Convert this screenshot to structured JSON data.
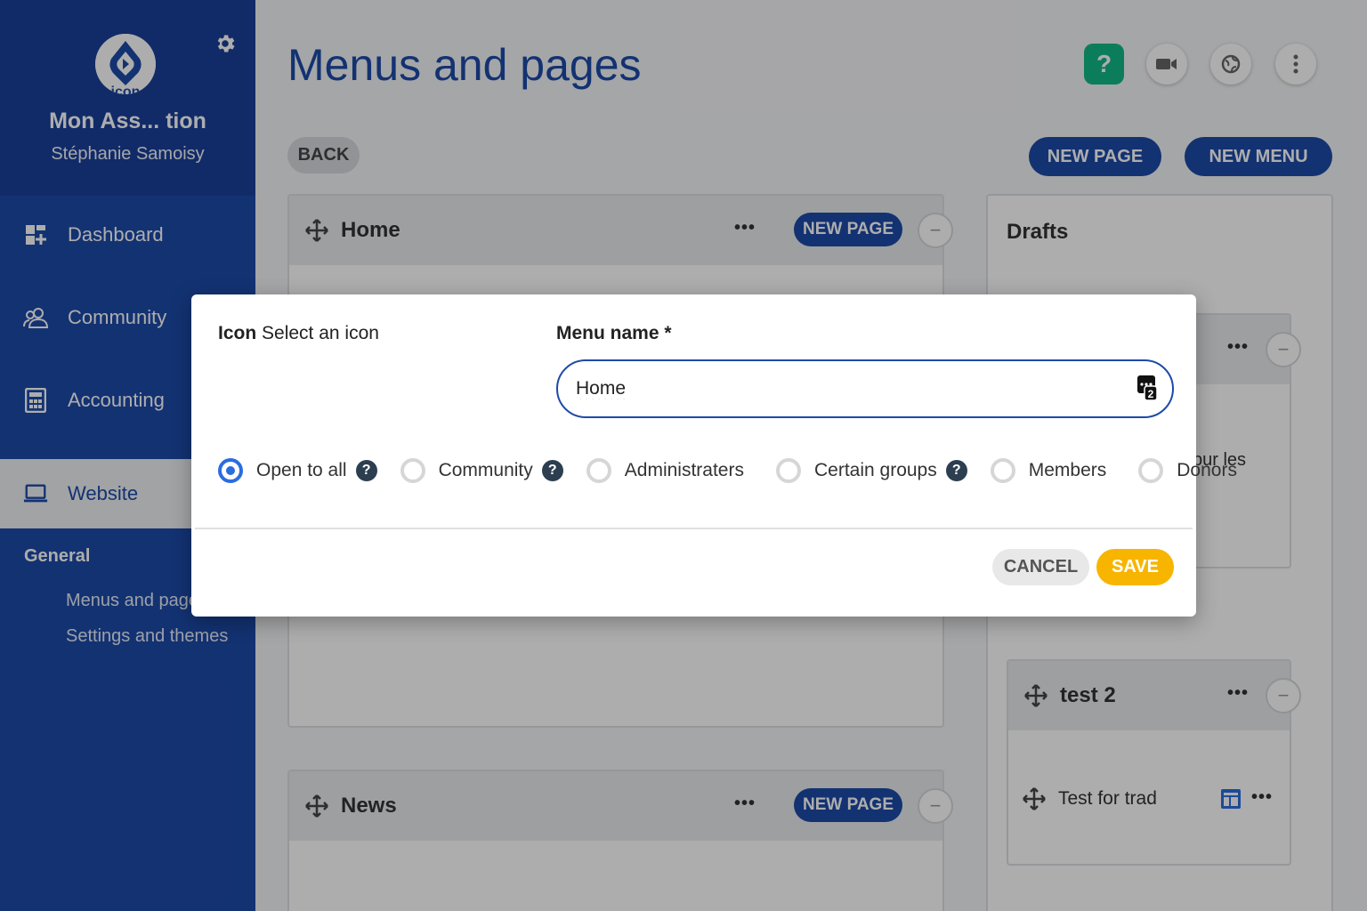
{
  "sidebar": {
    "org_name": "Mon Ass... tion",
    "user_name": "Stéphanie Samoisy",
    "logo_text": "icon",
    "nav": [
      {
        "label": "Dashboard",
        "icon": "dashboard-icon"
      },
      {
        "label": "Community",
        "icon": "community-icon"
      },
      {
        "label": "Accounting",
        "icon": "calculator-icon"
      },
      {
        "label": "Website",
        "icon": "laptop-icon"
      }
    ],
    "section_title": "General",
    "sub_items": [
      "Menus and pages",
      "Settings and themes"
    ]
  },
  "header": {
    "title": "Menus and pages",
    "help_label": "?"
  },
  "toolbar": {
    "back_label": "BACK",
    "new_page_label": "NEW PAGE",
    "new_menu_label": "NEW MENU"
  },
  "menus": [
    {
      "title": "Home",
      "new_page_label": "NEW PAGE",
      "more_label": "•••",
      "collapse_label": "−"
    },
    {
      "title": "News",
      "new_page_label": "NEW PAGE",
      "more_label": "•••",
      "collapse_label": "−"
    }
  ],
  "drafts": {
    "title": "Drafts",
    "partial_text": "pur les",
    "card_more_label": "•••",
    "collapse_label": "−",
    "test_menu": {
      "title": "test 2",
      "page_label": "Test for trad",
      "more_label": "•••"
    }
  },
  "dialog": {
    "icon_label": "Icon",
    "icon_hint": "Select an icon",
    "menu_name_label": "Menu name *",
    "menu_name_value": "Home",
    "badge_text": "2",
    "visibility_options": [
      {
        "label": "Open to all",
        "checked": true,
        "help": true
      },
      {
        "label": "Community",
        "checked": false,
        "help": true
      },
      {
        "label": "Administraters",
        "checked": false,
        "help": false
      },
      {
        "label": "Certain groups",
        "checked": false,
        "help": true
      },
      {
        "label": "Members",
        "checked": false,
        "help": false
      },
      {
        "label": "Donors",
        "checked": false,
        "help": false
      }
    ],
    "help_glyph": "?",
    "cancel_label": "CANCEL",
    "save_label": "SAVE"
  },
  "colors": {
    "brand": "#1d4aa8",
    "accent_save": "#f7b500",
    "help_green": "#12b886",
    "radio_selected": "#2a6de0"
  }
}
